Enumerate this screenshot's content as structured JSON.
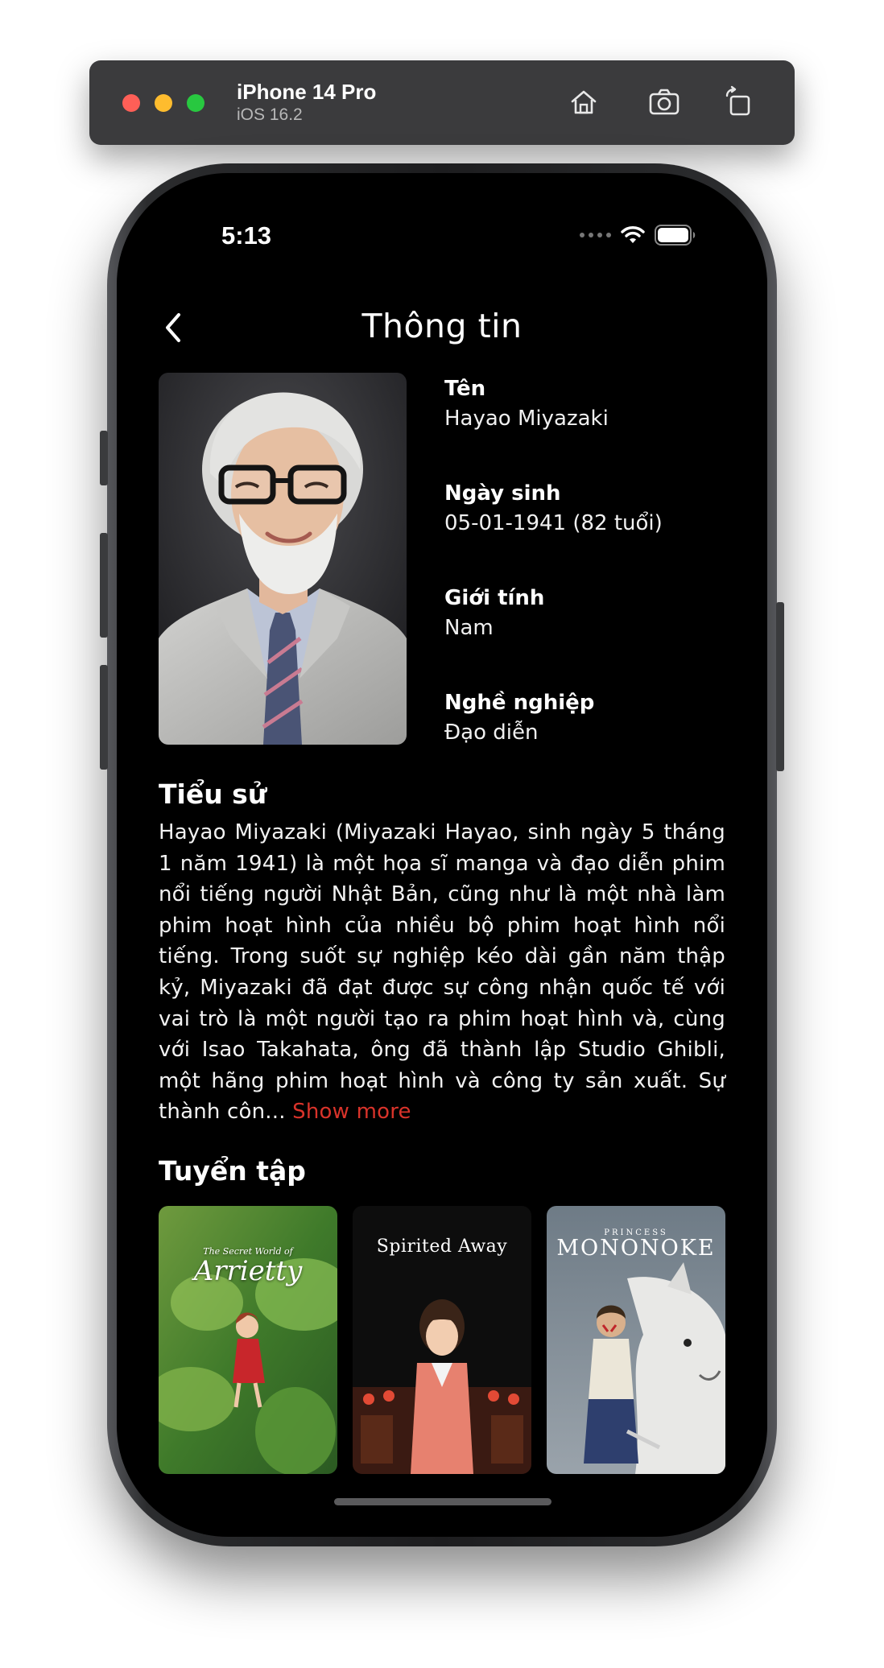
{
  "simulator": {
    "device_name": "iPhone 14 Pro",
    "os_version": "iOS 16.2",
    "buttons": [
      "home-icon",
      "screenshot-icon",
      "rotate-icon"
    ]
  },
  "status_bar": {
    "time": "5:13"
  },
  "nav": {
    "title": "Thông tin"
  },
  "profile": {
    "fields": [
      {
        "label": "Tên",
        "value": "Hayao Miyazaki"
      },
      {
        "label": "Ngày sinh",
        "value": "05-01-1941 (82 tuổi)"
      },
      {
        "label": "Giới tính",
        "value": "Nam"
      },
      {
        "label": "Nghề nghiệp",
        "value": "Đạo diễn"
      }
    ]
  },
  "biography": {
    "title": "Tiểu sử",
    "text": "Hayao Miyazaki (Miyazaki Hayao, sinh ngày 5 tháng 1 năm 1941) là một họa sĩ manga và đạo diễn phim nổi tiếng người Nhật Bản, cũng như là một nhà làm phim hoạt hình của nhiều bộ phim hoạt hình nổi tiếng. Trong suốt sự nghiệp kéo dài gần năm thập kỷ, Miyazaki đã đạt được sự công nhận quốc tế với vai trò là một người tạo ra phim hoạt hình và, cùng với Isao Takahata, ông đã thành lập Studio Ghibli, một hãng phim hoạt hình và công ty sản xuất. Sự thành côn...",
    "show_more": "Show more"
  },
  "collection": {
    "title": "Tuyển tập",
    "posters": [
      {
        "title_small": "The Secret World of",
        "title_big": "Arrietty"
      },
      {
        "title_big": "Spirited Away"
      },
      {
        "title_small": "PRINCESS",
        "title_big": "MONONOKE"
      }
    ]
  },
  "colors": {
    "background": "#000000",
    "accent": "#d9332a",
    "text": "#ffffff"
  }
}
